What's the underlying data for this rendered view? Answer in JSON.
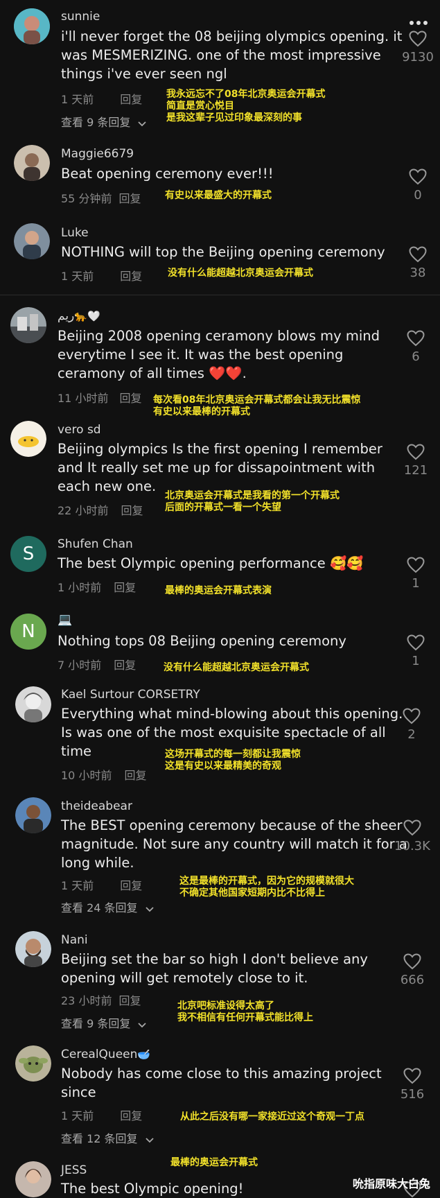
{
  "comments": [
    {
      "username": "sunnie",
      "lines": [
        "i'll never forget the 08 beijing olympics opening. it",
        "was MESMERIZING. one of the most impressive",
        "things i've ever seen ngl"
      ],
      "time": "1 天前",
      "reply": "回复",
      "likes": "9130",
      "translation": [
        "我永远忘不了08年北京奥运会开幕式",
        "简直是赏心悦目",
        "是我这辈子见过印象最深刻的事"
      ],
      "views": "查看 9 条回复"
    },
    {
      "username": "Maggie6679",
      "lines": [
        "Beat opening ceremony ever!!!"
      ],
      "time": "55 分钟前",
      "reply": "回复",
      "likes": "0",
      "translation": [
        "有史以来最盛大的开幕式"
      ]
    },
    {
      "username": "Luke",
      "lines": [
        "NOTHING will top the Beijing opening ceremony"
      ],
      "time": "1 天前",
      "reply": "回复",
      "likes": "38",
      "translation": [
        "没有什么能超越北京奥运会开幕式"
      ]
    },
    {
      "username": "ريم",
      "username_emojis": "🐆🤍",
      "lines": [
        "Beijing 2008 opening ceramony blows my mind",
        "everytime I see it. It was the best opening",
        "ceramony of all times ❤️❤️."
      ],
      "time": "11 小时前",
      "reply": "回复",
      "likes": "6",
      "translation": [
        "每次看08年北京奥运会开幕式都会让我无比震惊",
        "有史以来最棒的开幕式"
      ]
    },
    {
      "username": "vero sd",
      "lines": [
        "Beijing olympics Is the first opening I remember",
        "and It really set me up for dissapointment with",
        "each new one."
      ],
      "time": "22 小时前",
      "reply": "回复",
      "likes": "121",
      "translation": [
        "北京奥运会开幕式是我看的第一个开幕式",
        "后面的开幕式一看一个失望"
      ]
    },
    {
      "username": "Shufen Chan",
      "avatar_letter": "S",
      "lines": [
        "The best Olympic opening performance 🥰🥰"
      ],
      "time": "1 小时前",
      "reply": "回复",
      "likes": "1",
      "translation": [
        "最棒的奥运会开幕式表演"
      ]
    },
    {
      "username": "💻",
      "avatar_letter": "N",
      "lines": [
        "Nothing tops 08 Beijing opening ceremony"
      ],
      "time": "7 小时前",
      "reply": "回复",
      "likes": "1",
      "translation": [
        "没有什么能超越北京奥运会开幕式"
      ]
    },
    {
      "username": "Kael Surtour CORSETRY",
      "lines": [
        "Everything what mind-blowing about this opening.",
        "Is was one of the most exquisite spectacle of all",
        "time"
      ],
      "time": "10 小时前",
      "reply": "回复",
      "likes": "2",
      "translation": [
        "这场开幕式的每一刻都让我震惊",
        "这是有史以来最精美的奇观"
      ]
    },
    {
      "username": "theideabear",
      "lines": [
        "The BEST opening ceremony because of the sheer",
        "magnitude. Not sure any country will match it for a",
        "long while."
      ],
      "time": "1 天前",
      "reply": "回复",
      "likes": "10.3K",
      "translation": [
        "这是最棒的开幕式，因为它的规模就很大",
        "不确定其他国家短期内比不比得上"
      ],
      "views": "查看 24 条回复"
    },
    {
      "username": "Nani",
      "lines": [
        "Beijing set the bar so high I don't believe any",
        "opening will get remotely close to it."
      ],
      "time": "23 小时前",
      "reply": "回复",
      "likes": "666",
      "translation": [
        "北京吧标准设得太高了",
        "我不相信有任何开幕式能比得上"
      ],
      "views": "查看 9 条回复"
    },
    {
      "username": "CerealQueen",
      "username_emojis": "🥣",
      "lines": [
        "Nobody has come close to this amazing project",
        "since"
      ],
      "time": "1 天前",
      "reply": "回复",
      "likes": "516",
      "translation": [
        "从此之后没有哪一家接近过这个奇观一丁点"
      ],
      "views": "查看 12 条回复"
    },
    {
      "username": "JESS",
      "lines": [
        "The best Olympic opening!"
      ],
      "translation_above": "最棒的奥运会开幕式"
    }
  ],
  "watermark": "吮指原味大白兔",
  "colors": {
    "background": "#111111",
    "translation": "#f2e12a",
    "meta": "#8a8a8a",
    "shufen_avatar": "#1f6a5e",
    "n_avatar": "#6aa84f"
  }
}
